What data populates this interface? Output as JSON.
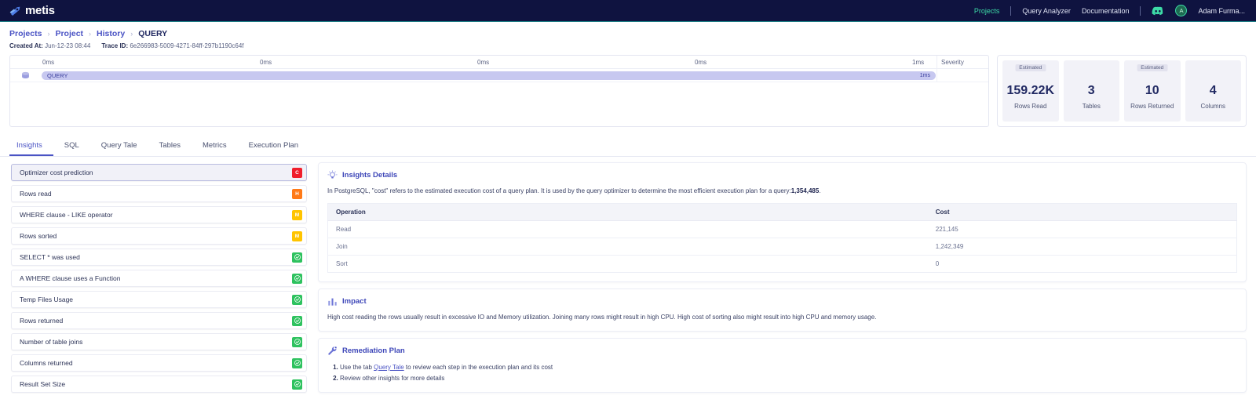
{
  "navbar": {
    "logo_text": "metis",
    "logo_icon": "rocket-icon",
    "links": [
      {
        "label": "Projects",
        "active": true
      },
      {
        "label": "Query Analyzer",
        "active": false
      },
      {
        "label": "Documentation",
        "active": false
      }
    ],
    "discord_icon": "discord-icon",
    "avatar_initial": "A",
    "user_name": "Adam Furma...",
    "accent_color": "#3ddba7",
    "background_color": "#0f1340"
  },
  "breadcrumb": {
    "items": [
      "Projects",
      "Project",
      "History",
      "QUERY"
    ],
    "separator": "›"
  },
  "meta": {
    "created_label": "Created At:",
    "created_value": "Jun-12-23 08:44",
    "trace_label": "Trace ID:",
    "trace_value": "6e266983-5009-4271-84ff-297b1190c64f"
  },
  "trace": {
    "ticks": [
      "0ms",
      "0ms",
      "0ms",
      "0ms",
      "1ms"
    ],
    "severity_header": "Severity",
    "row": {
      "db_icon": "database-icon",
      "span_label": "QUERY",
      "duration": "1ms"
    }
  },
  "stats": [
    {
      "badge": "Estimated",
      "value": "159.22K",
      "label": "Rows Read"
    },
    {
      "badge": "",
      "value": "3",
      "label": "Tables"
    },
    {
      "badge": "Estimated",
      "value": "10",
      "label": "Rows Returned"
    },
    {
      "badge": "",
      "value": "4",
      "label": "Columns"
    }
  ],
  "tabs": [
    {
      "label": "Insights",
      "active": true
    },
    {
      "label": "SQL",
      "active": false
    },
    {
      "label": "Query Tale",
      "active": false
    },
    {
      "label": "Tables",
      "active": false
    },
    {
      "label": "Metrics",
      "active": false
    },
    {
      "label": "Execution Plan",
      "active": false
    }
  ],
  "insights": [
    {
      "title": "Optimizer cost prediction",
      "severity": "C",
      "level": "c",
      "selected": true
    },
    {
      "title": "Rows read",
      "severity": "H",
      "level": "h",
      "selected": false
    },
    {
      "title": "WHERE clause - LIKE operator",
      "severity": "M",
      "level": "m",
      "selected": false
    },
    {
      "title": "Rows sorted",
      "severity": "M",
      "level": "m",
      "selected": false
    },
    {
      "title": "SELECT * was used",
      "severity": "",
      "level": "ok",
      "selected": false
    },
    {
      "title": "A WHERE clause uses a Function",
      "severity": "",
      "level": "ok",
      "selected": false
    },
    {
      "title": "Temp Files Usage",
      "severity": "",
      "level": "ok",
      "selected": false
    },
    {
      "title": "Rows returned",
      "severity": "",
      "level": "ok",
      "selected": false
    },
    {
      "title": "Number of table joins",
      "severity": "",
      "level": "ok",
      "selected": false
    },
    {
      "title": "Columns returned",
      "severity": "",
      "level": "ok",
      "selected": false
    },
    {
      "title": "Result Set Size",
      "severity": "",
      "level": "ok",
      "selected": false
    }
  ],
  "details": {
    "icon": "lightbulb-icon",
    "title": "Insights Details",
    "text_before": "In PostgreSQL, \"cost\" refers to the estimated execution cost of a query plan. It is used by the query optimizer to determine the most efficient execution plan for a query:",
    "text_bold": "1,354,485",
    "text_after": ".",
    "table": {
      "columns": [
        "Operation",
        "Cost"
      ],
      "rows": [
        {
          "operation": "Read",
          "cost": "221,145"
        },
        {
          "operation": "Join",
          "cost": "1,242,349"
        },
        {
          "operation": "Sort",
          "cost": "0"
        }
      ]
    }
  },
  "impact": {
    "icon": "bar-chart-icon",
    "title": "Impact",
    "text": "High cost reading the rows usually result in excessive IO and Memory utilization. Joining many rows might result in high CPU. High cost of sorting also might result into high CPU and memory usage."
  },
  "remediation": {
    "icon": "wrench-icon",
    "title": "Remediation Plan",
    "steps": [
      {
        "before": "Use the tab ",
        "link": "Query Tale",
        "after": " to review each step in the execution plan and its cost"
      },
      {
        "before": "Review other insights for more details",
        "link": "",
        "after": ""
      }
    ]
  }
}
